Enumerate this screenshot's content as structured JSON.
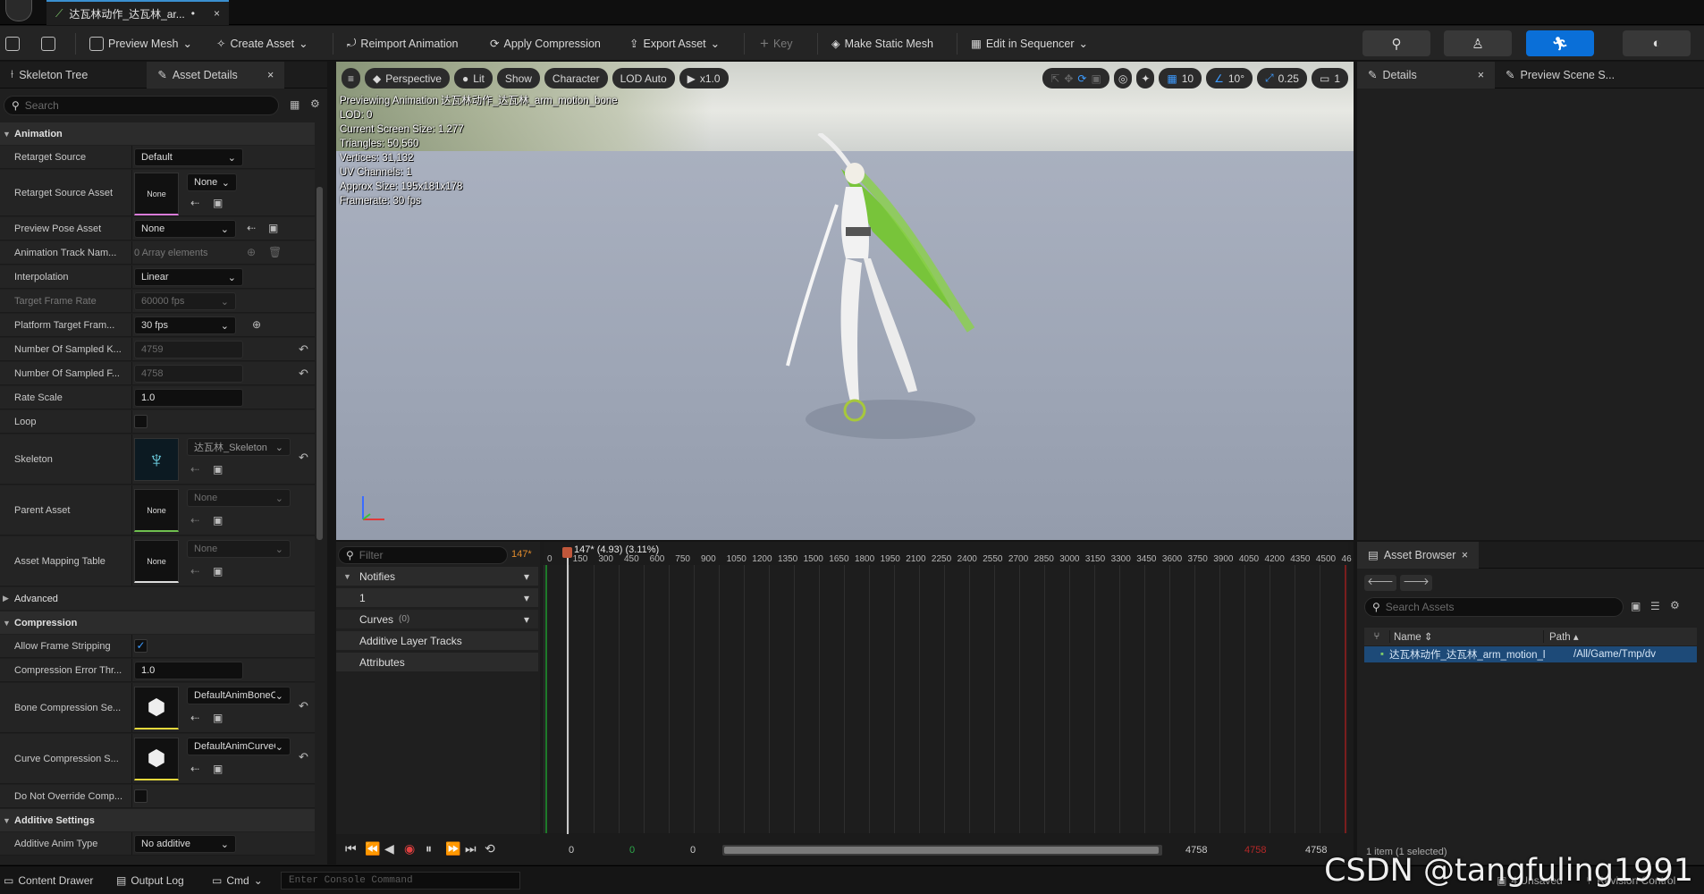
{
  "document_tab": {
    "title": "达瓦林动作_达瓦林_ar...",
    "modified": "•",
    "close": "×"
  },
  "toolbar": {
    "preview_mesh": "Preview Mesh",
    "create_asset": "Create Asset",
    "reimport": "Reimport Animation",
    "apply_compression": "Apply Compression",
    "export_asset": "Export Asset",
    "key": "Key",
    "make_static_mesh": "Make Static Mesh",
    "edit_in_sequencer": "Edit in Sequencer"
  },
  "left_panel": {
    "tabs": [
      "Skeleton Tree",
      "Asset Details"
    ],
    "search_placeholder": "Search",
    "sections": {
      "animation": "Animation",
      "advanced": "Advanced",
      "compression": "Compression",
      "additive": "Additive Settings"
    },
    "props": {
      "retarget_source": {
        "label": "Retarget Source",
        "value": "Default"
      },
      "retarget_source_asset": {
        "label": "Retarget Source Asset",
        "value": "None",
        "thumb": "None"
      },
      "preview_pose": {
        "label": "Preview Pose Asset",
        "value": "None"
      },
      "anim_track_names": {
        "label": "Animation Track Nam...",
        "value": "0 Array elements"
      },
      "interpolation": {
        "label": "Interpolation",
        "value": "Linear"
      },
      "target_frame_rate": {
        "label": "Target Frame Rate",
        "value": "60000 fps"
      },
      "platform_target_frame": {
        "label": "Platform Target Fram...",
        "value": "30 fps"
      },
      "num_sampled_keys": {
        "label": "Number Of Sampled K...",
        "value": "4759"
      },
      "num_sampled_frames": {
        "label": "Number Of Sampled F...",
        "value": "4758"
      },
      "rate_scale": {
        "label": "Rate Scale",
        "value": "1.0"
      },
      "loop": {
        "label": "Loop"
      },
      "skeleton": {
        "label": "Skeleton",
        "value": "达瓦林_Skeleton"
      },
      "parent_asset": {
        "label": "Parent Asset",
        "value": "None",
        "thumb": "None"
      },
      "asset_mapping_table": {
        "label": "Asset Mapping Table",
        "value": "None",
        "thumb": "None"
      },
      "allow_frame_stripping": {
        "label": "Allow Frame Stripping"
      },
      "compression_error": {
        "label": "Compression Error Thr...",
        "value": "1.0"
      },
      "bone_compression": {
        "label": "Bone Compression Se...",
        "value": "DefaultAnimBoneCo"
      },
      "curve_compression": {
        "label": "Curve Compression S...",
        "value": "DefaultAnimCurveC"
      },
      "do_not_override": {
        "label": "Do Not Override Comp..."
      },
      "additive_anim_type": {
        "label": "Additive Anim Type",
        "value": "No additive"
      }
    }
  },
  "viewport": {
    "perspective": "Perspective",
    "lit": "Lit",
    "show": "Show",
    "character": "Character",
    "lod": "LOD Auto",
    "speed": "x1.0",
    "grid_snap": "10",
    "rot_snap": "10°",
    "scale_snap": "0.25",
    "camera_speed": "1",
    "stats": [
      "Previewing Animation 达瓦林动作_达瓦林_arm_motion_bone",
      "LOD: 0",
      "Current Screen Size: 1.277",
      "Triangles: 50,560",
      "Vertices: 31,132",
      "UV Channels: 1",
      "Approx Size: 195x181x178",
      "Framerate: 30 fps"
    ]
  },
  "details_panel": {
    "tabs": [
      "Details",
      "Preview Scene S..."
    ]
  },
  "sequencer": {
    "filter_placeholder": "Filter",
    "current_frame": "147*",
    "playhead_label": "147* (4.93) (3.11%)",
    "tracks": {
      "notifies": "Notifies",
      "notify_track": "1",
      "curves": "Curves",
      "curves_count": "(0)",
      "additive": "Additive Layer Tracks",
      "attributes": "Attributes"
    },
    "ruler": [
      "0",
      "150",
      "300",
      "450",
      "600",
      "750",
      "900",
      "1050",
      "1200",
      "1350",
      "1500",
      "1650",
      "1800",
      "1950",
      "2100",
      "2250",
      "2400",
      "2550",
      "2700",
      "2850",
      "3000",
      "3150",
      "3300",
      "3450",
      "3600",
      "3750",
      "3900",
      "4050",
      "4200",
      "4350",
      "4500",
      "46"
    ],
    "range_start": "0",
    "range_start2": "0",
    "range_start3": "0",
    "range_end": "4758",
    "range_end_red": "4758",
    "range_end2": "4758"
  },
  "asset_browser": {
    "tab": "Asset Browser",
    "search_placeholder": "Search Assets",
    "col_name": "Name",
    "col_path": "Path",
    "row_name": "达瓦林动作_达瓦林_arm_motion_l",
    "row_path": "/All/Game/Tmp/dv",
    "footer": "1 item (1 selected)"
  },
  "statusbar": {
    "content_drawer": "Content Drawer",
    "output_log": "Output Log",
    "cmd": "Cmd",
    "console_placeholder": "Enter Console Command",
    "unsaved": "4 Unsaved",
    "revision": "Revision Control"
  },
  "watermark": "CSDN @tangfuling1991",
  "colors": {
    "accent": "#0a6fd8",
    "tab_underline": "#3a8fd0",
    "playhead": "#c0573b"
  }
}
